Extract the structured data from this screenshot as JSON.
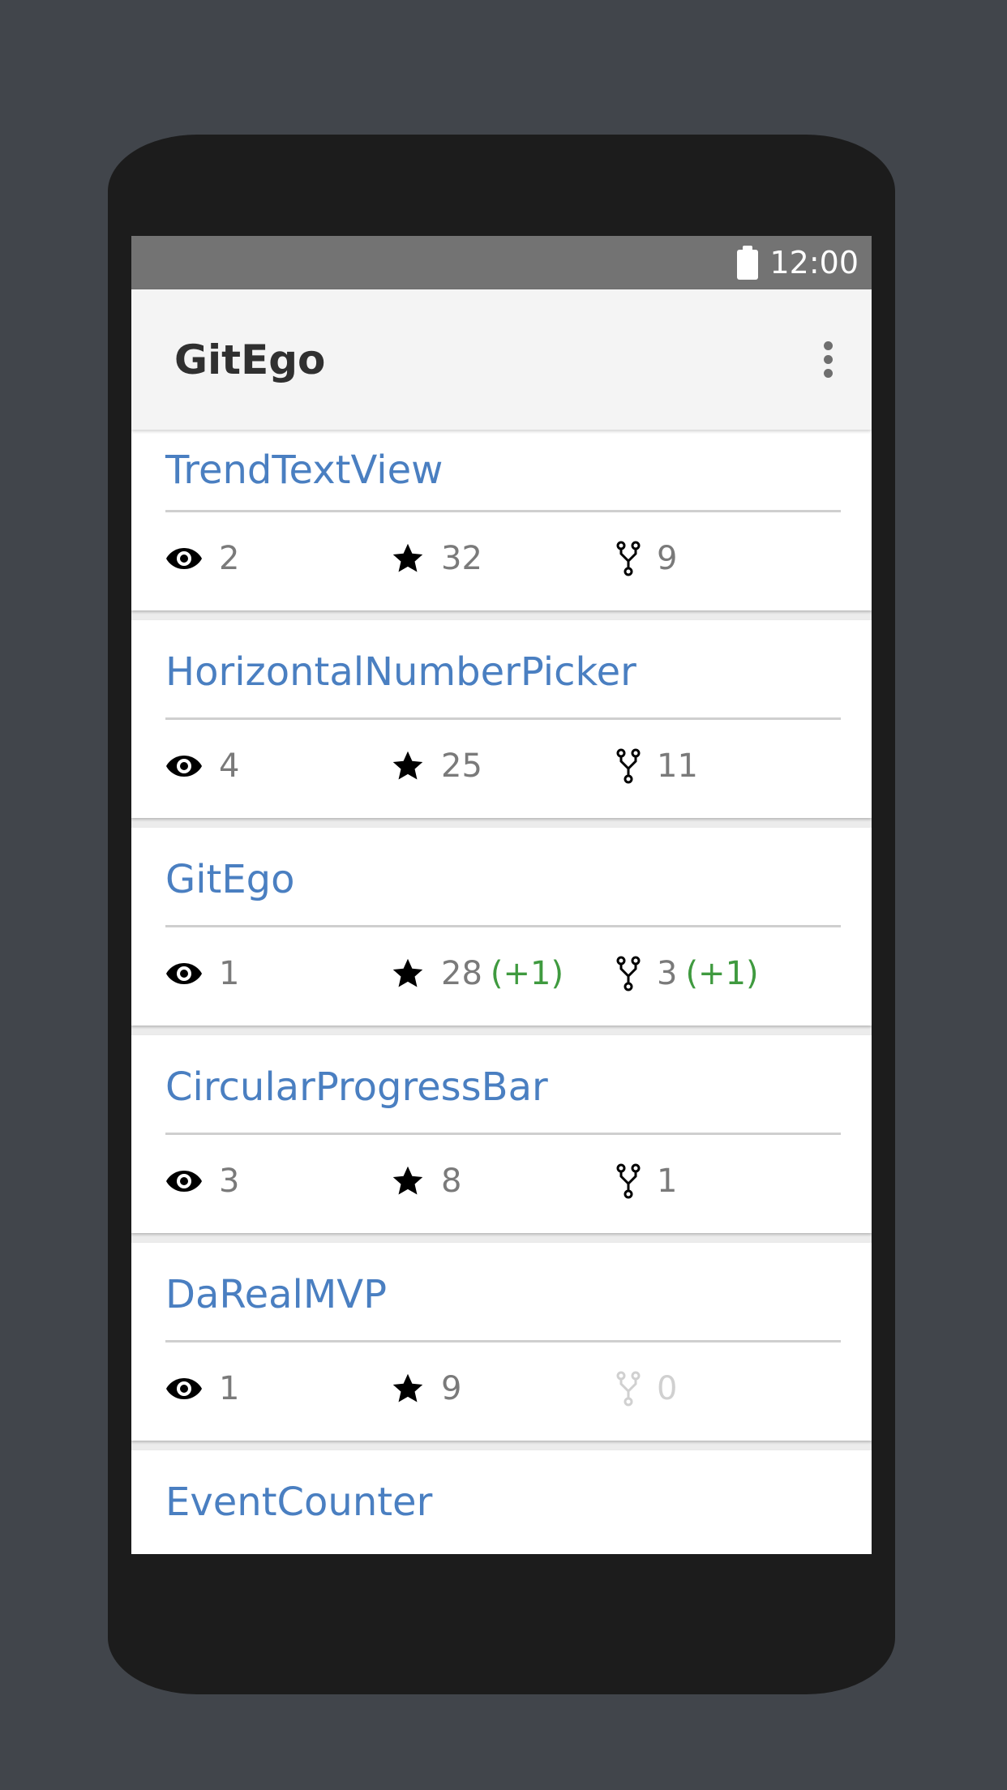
{
  "status_bar": {
    "time": "12:00"
  },
  "app_bar": {
    "title": "GitEgo"
  },
  "repos": [
    {
      "name": "TrendTextView",
      "watchers": "2",
      "stars": "32",
      "stars_delta": "",
      "forks": "9",
      "forks_delta": ""
    },
    {
      "name": "HorizontalNumberPicker",
      "watchers": "4",
      "stars": "25",
      "stars_delta": "",
      "forks": "11",
      "forks_delta": ""
    },
    {
      "name": "GitEgo",
      "watchers": "1",
      "stars": "28",
      "stars_delta": "(+1)",
      "forks": "3",
      "forks_delta": "(+1)"
    },
    {
      "name": "CircularProgressBar",
      "watchers": "3",
      "stars": "8",
      "stars_delta": "",
      "forks": "1",
      "forks_delta": ""
    },
    {
      "name": "DaRealMVP",
      "watchers": "1",
      "stars": "9",
      "stars_delta": "",
      "forks": "0",
      "forks_delta": ""
    },
    {
      "name": "EventCounter"
    }
  ],
  "colors": {
    "repo_name": "#4a7fc1",
    "delta": "#3f9a3f",
    "app_bar": "#f4f4f4",
    "status_bar": "#737373"
  },
  "icons": {
    "watchers": "eye-icon",
    "stars": "star-icon",
    "forks": "fork-icon",
    "overflow": "more-vert-icon",
    "battery": "battery-icon"
  }
}
